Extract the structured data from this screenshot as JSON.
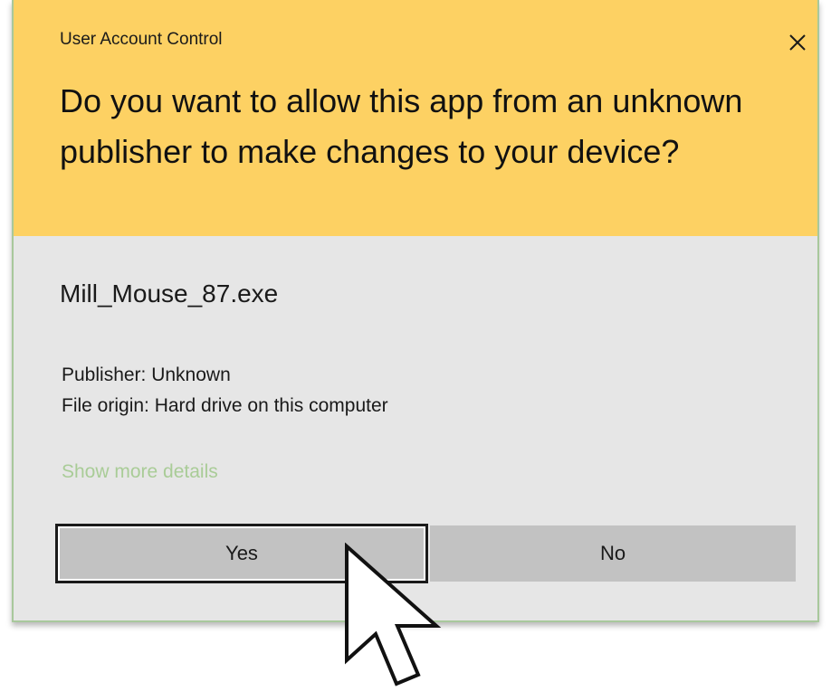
{
  "dialog": {
    "title": "User Account Control",
    "close_icon": "close-icon",
    "question": "Do you want to allow this app from an unknown publisher to make changes to your device?",
    "app_name": "Mill_Mouse_87.exe",
    "publisher": "Publisher: Unknown",
    "file_origin": "File origin: Hard drive on this computer",
    "details_link": "Show more details",
    "buttons": {
      "yes": "Yes",
      "no": "No"
    }
  },
  "cursor": "mouse-pointer-icon",
  "colors": {
    "header_bg": "#fdd163",
    "body_bg": "#e6e6e6",
    "border": "#a8c89c",
    "link": "#a9cc97",
    "button_bg": "#c2c2c2"
  }
}
